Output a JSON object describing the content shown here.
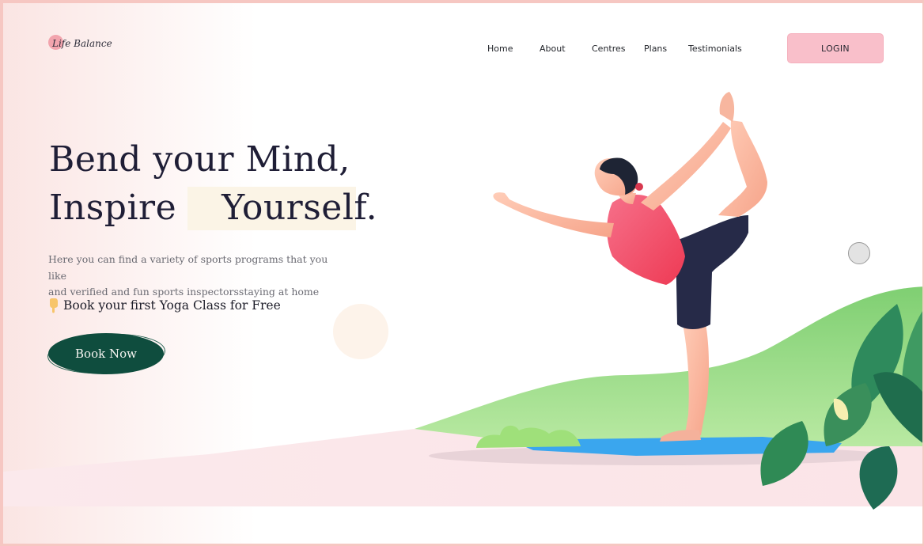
{
  "brand": {
    "name": "Life Balance",
    "accent": "#f2a4ad"
  },
  "nav": {
    "items": [
      "Home",
      "About",
      "Centres",
      "Plans",
      "Testimonials"
    ],
    "login_label": "LOGIN"
  },
  "hero": {
    "headline_line1": "Bend your Mind,",
    "headline_line2_prefix": "Inspire",
    "headline_line2_highlight": "Yourself.",
    "subtext_line1": "Here you can find a variety of sports programs that you like",
    "subtext_line2": "and verified and fun sports inspectorsstaying at home",
    "cta_text": "Book your first Yoga Class for Free",
    "cta_icon": "pointing-finger-icon",
    "book_button_label": "Book Now"
  },
  "colors": {
    "heading": "#1f1e36",
    "button_dark_green": "#0f4d3e",
    "login_pink": "#f9bfca",
    "hill_green": "#8fd87f",
    "mat_blue": "#3aa6ee",
    "tank_top": "#f04a63"
  }
}
